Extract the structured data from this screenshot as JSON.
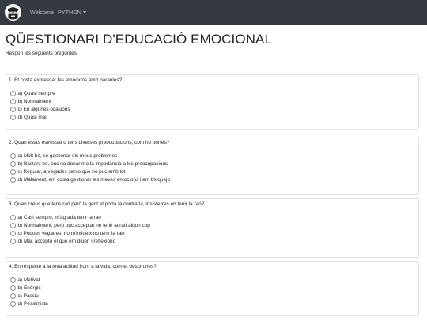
{
  "navbar": {
    "links": [
      {
        "label": "Welcome"
      },
      {
        "label": "PYTHON"
      }
    ]
  },
  "page": {
    "title": "QÜESTIONARI D'EDUCACIÓ EMOCIONAL",
    "subtitle": "Respon les següents preguntes"
  },
  "questions": [
    {
      "text": "1. Et costa expressar les emocions amb paraules?",
      "options": [
        "a) Quasi sempre",
        "b) Normalment",
        "c) En algunes ocasions",
        "d) Quasi mai"
      ]
    },
    {
      "text": "2. Quan estàs estressat o tens diverses preocupacions, com ho portes?",
      "options": [
        "a) Molt bé, sé gestionar els meus problemes",
        "b) Bastant bé, puc no donar molta importància a les preocupacions",
        "c) Regular, a vegades sento que no puc amb tot",
        "d) Malament, em costa gestionar les meves emocions i em bloquejo"
      ]
    },
    {
      "text": "3. Quan creus que tens raó però la gent et porta la contraria, insisteixes en tenir la raó?",
      "options": [
        "a) Casi sempre, m'agrada tenir la raó",
        "b) Normalment, però puc acceptar no tenir la raó algun cop",
        "c) Poques vegades, no m'influeix no tenir la raó",
        "d) Mai, accepto el que em diuen i reflexiono"
      ]
    },
    {
      "text": "4. En respecte a la teva actitud front a la vida, com et descriuries?",
      "options": [
        "a) Motivat",
        "b) Enèrgic",
        "c) Passiu",
        "d) Pessimista"
      ]
    }
  ]
}
